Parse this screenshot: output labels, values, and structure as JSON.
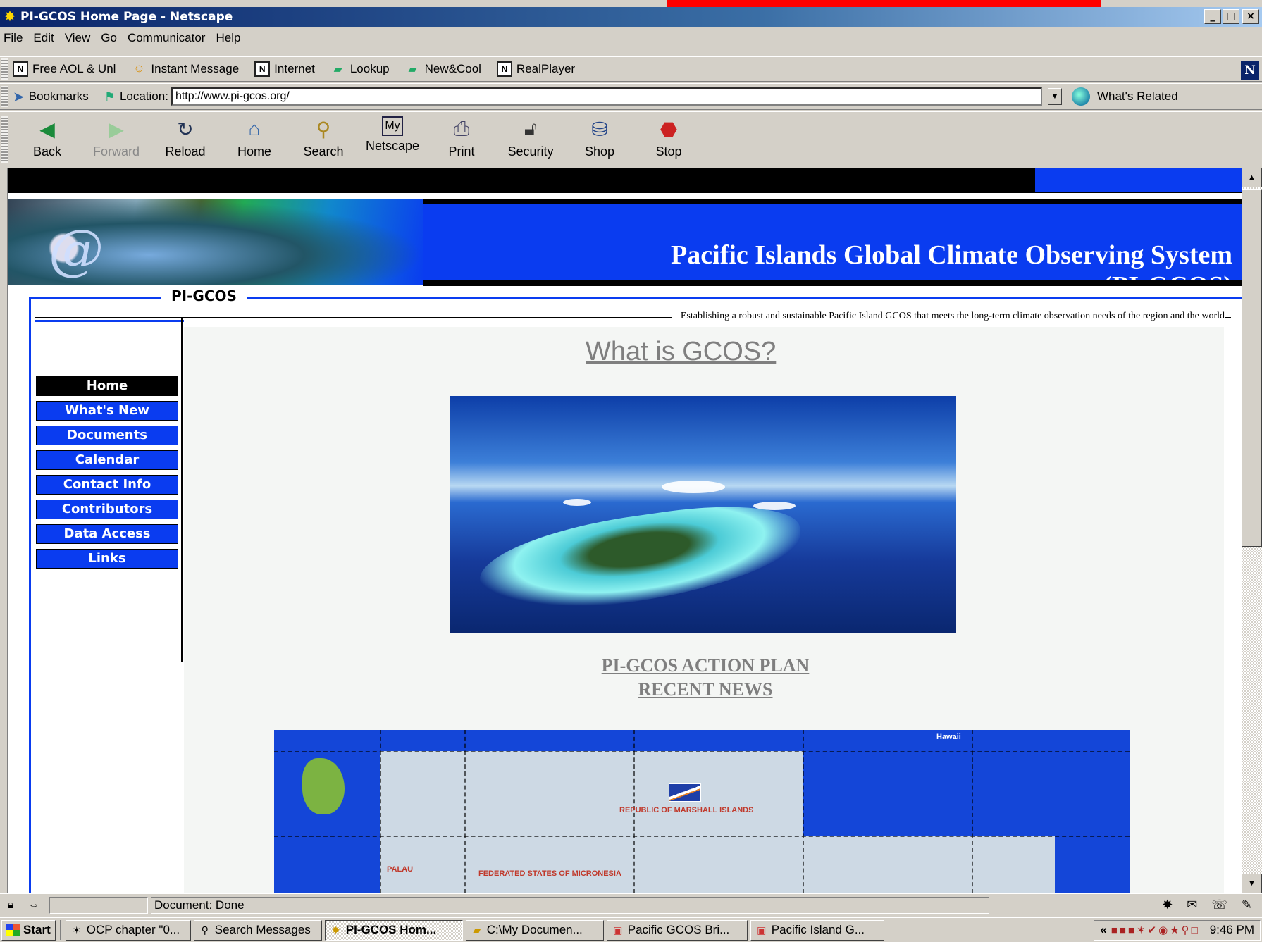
{
  "window": {
    "title": "PI-GCOS Home Page - Netscape",
    "controls": [
      "_",
      "□",
      "×"
    ]
  },
  "menu": [
    "File",
    "Edit",
    "View",
    "Go",
    "Communicator",
    "Help"
  ],
  "personal_toolbar": [
    {
      "label": "Free AOL & Unl",
      "icon": "bookmark-doc-icon"
    },
    {
      "label": "Instant Message",
      "icon": "instant-message-icon"
    },
    {
      "label": "Internet",
      "icon": "bookmark-doc-icon"
    },
    {
      "label": "Lookup",
      "icon": "folder-icon"
    },
    {
      "label": "New&Cool",
      "icon": "folder-icon"
    },
    {
      "label": "RealPlayer",
      "icon": "bookmark-doc-icon"
    }
  ],
  "location_bar": {
    "bookmarks_label": "Bookmarks",
    "location_label": "Location:",
    "url": "http://www.pi-gcos.org/",
    "related_label": "What's Related"
  },
  "nav_toolbar": [
    {
      "label": "Back",
      "icon": "back-arrow-icon",
      "enabled": true
    },
    {
      "label": "Forward",
      "icon": "forward-arrow-icon",
      "enabled": false
    },
    {
      "label": "Reload",
      "icon": "reload-icon",
      "enabled": true
    },
    {
      "label": "Home",
      "icon": "home-icon",
      "enabled": true
    },
    {
      "label": "Search",
      "icon": "search-icon",
      "enabled": true
    },
    {
      "label": "Netscape",
      "icon": "my-netscape-icon",
      "enabled": true
    },
    {
      "label": "Print",
      "icon": "print-icon",
      "enabled": true
    },
    {
      "label": "Security",
      "icon": "security-lock-icon",
      "enabled": true
    },
    {
      "label": "Shop",
      "icon": "shop-bag-icon",
      "enabled": true
    },
    {
      "label": "Stop",
      "icon": "stop-icon",
      "enabled": true
    }
  ],
  "page": {
    "banner_title_line1": "Pacific Islands Global Climate Observing System",
    "banner_title_line2": "(PI-GCOS)",
    "section_label": "PI-GCOS",
    "tagline": "Establishing a robust and sustainable Pacific Island GCOS that meets the long-term climate observation needs of the region and the world",
    "heading": "What is GCOS?",
    "nav": [
      {
        "label": "Home",
        "active": true
      },
      {
        "label": "What's New",
        "active": false
      },
      {
        "label": "Documents",
        "active": false
      },
      {
        "label": "Calendar",
        "active": false
      },
      {
        "label": "Contact Info",
        "active": false
      },
      {
        "label": "Contributors",
        "active": false
      },
      {
        "label": "Data Access",
        "active": false
      },
      {
        "label": "Links",
        "active": false
      }
    ],
    "links": [
      "PI-GCOS ACTION PLAN",
      "RECENT NEWS"
    ],
    "map_labels": {
      "marshall": "REPUBLIC OF MARSHALL ISLANDS",
      "micronesia": "FEDERATED STATES OF MICRONESIA",
      "palau": "PALAU",
      "hawaii": "Hawaii"
    }
  },
  "statusbar": {
    "status_text": "Document: Done"
  },
  "taskbar": {
    "start_label": "Start",
    "tasks": [
      {
        "label": "OCP chapter \"0...",
        "icon": "document-icon",
        "active": false
      },
      {
        "label": "Search Messages",
        "icon": "search-icon",
        "active": false
      },
      {
        "label": "PI-GCOS Hom...",
        "icon": "netscape-icon",
        "active": true
      },
      {
        "label": "C:\\My Documen...",
        "icon": "folder-icon",
        "active": false
      },
      {
        "label": "Pacific GCOS Bri...",
        "icon": "powerpoint-icon",
        "active": false
      },
      {
        "label": "Pacific Island G...",
        "icon": "powerpoint-icon",
        "active": false
      }
    ],
    "tray_chevron": "«",
    "clock": "9:46 PM"
  },
  "colors": {
    "page_blue": "#0a3cf0",
    "title_bar": "#0a246a",
    "link_gray": "#7f7f7f"
  }
}
